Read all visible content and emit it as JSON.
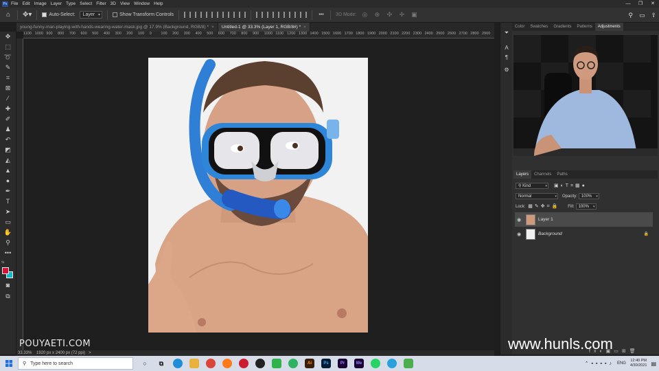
{
  "menubar": {
    "logo": "Ps",
    "items": [
      "File",
      "Edit",
      "Image",
      "Layer",
      "Type",
      "Select",
      "Filter",
      "3D",
      "View",
      "Window",
      "Help"
    ]
  },
  "options": {
    "auto_select_label": "Auto-Select:",
    "auto_select_value": "Layer",
    "transform_label": "Show Transform Controls",
    "mode_3d_label": "3D Mode:",
    "more": "•••"
  },
  "tabs": [
    {
      "label": "young-funny-man-playing-with-hands-wearing-water-mask.jpg @ 17.9% (Background, RGB/8) *",
      "close": "×"
    },
    {
      "label": "Untitled-1 @ 33.3% (Layer 1, RGB/8#) *",
      "close": "×"
    }
  ],
  "ruler": {
    "ticks": [
      "1100",
      "1000",
      "900",
      "800",
      "700",
      "600",
      "500",
      "400",
      "300",
      "200",
      "100",
      "0",
      "100",
      "200",
      "300",
      "400",
      "500",
      "600",
      "700",
      "800",
      "900",
      "1000",
      "1100",
      "1200",
      "1300",
      "1400",
      "1500",
      "1600",
      "1700",
      "1800",
      "1900",
      "2000",
      "2100",
      "2200",
      "2300",
      "2400",
      "2500",
      "2600",
      "2700",
      "2800",
      "2900"
    ]
  },
  "status": {
    "zoom": "33.33%",
    "size": "1920 px x 2400 px (72 ppi)",
    "arrow": ">"
  },
  "adjust_tabs": [
    "Color",
    "Swatches",
    "Gradients",
    "Patterns",
    "Adjustments"
  ],
  "layers_tabs": [
    "Layers",
    "Channels",
    "Paths"
  ],
  "layers_panel": {
    "filter_kind": "Kind",
    "blend_mode": "Normal",
    "opacity_label": "Opacity:",
    "opacity_value": "100%",
    "lock_label": "Lock:",
    "fill_label": "Fill:",
    "fill_value": "100%",
    "layers": [
      {
        "name": "Layer 1"
      },
      {
        "name": "Background"
      }
    ]
  },
  "watermarks": {
    "left": "POUYAETI.COM",
    "right": "www.hunls.com"
  },
  "taskbar": {
    "search_placeholder": "Type here to search",
    "apps": [
      "Ai",
      "Ps",
      "Pr",
      "Me"
    ],
    "lang": "ENG",
    "time": "12:40 PM",
    "date": "4/30/2021"
  },
  "colors": {
    "foreground": "#d4123a",
    "background": "#19b5c9"
  }
}
